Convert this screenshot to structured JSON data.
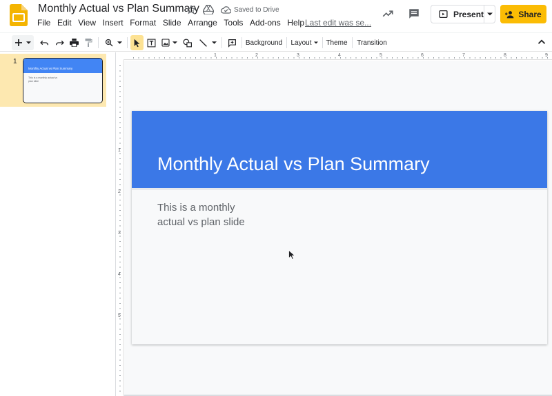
{
  "document": {
    "title": "Monthly Actual vs Plan Summary",
    "saved_status": "Saved to Drive",
    "last_edit": "Last edit was se..."
  },
  "menu": [
    "File",
    "Edit",
    "View",
    "Insert",
    "Format",
    "Slide",
    "Arrange",
    "Tools",
    "Add-ons",
    "Help"
  ],
  "header_actions": {
    "present_label": "Present",
    "share_label": "Share"
  },
  "toolbar": {
    "background_label": "Background",
    "layout_label": "Layout",
    "theme_label": "Theme",
    "transition_label": "Transition"
  },
  "filmstrip": {
    "slides": [
      {
        "number": "1",
        "title": "Monthly Actual vs Plan Summary",
        "body": "This is a monthly actual vs plan slide"
      }
    ]
  },
  "ruler": {
    "horizontal": [
      "1",
      "2",
      "3",
      "4",
      "5",
      "6",
      "7",
      "8",
      "9"
    ],
    "vertical": [
      "1",
      "2",
      "3",
      "4",
      "5"
    ]
  },
  "slide": {
    "title": "Monthly Actual vs Plan Summary",
    "body_line1": "This is a monthly",
    "body_line2": "actual vs plan slide"
  },
  "colors": {
    "slide_header": "#3b78e7",
    "share_button": "#fbbc04",
    "selected_slide_bg": "#fde8b0",
    "logo": "#f4b400"
  }
}
